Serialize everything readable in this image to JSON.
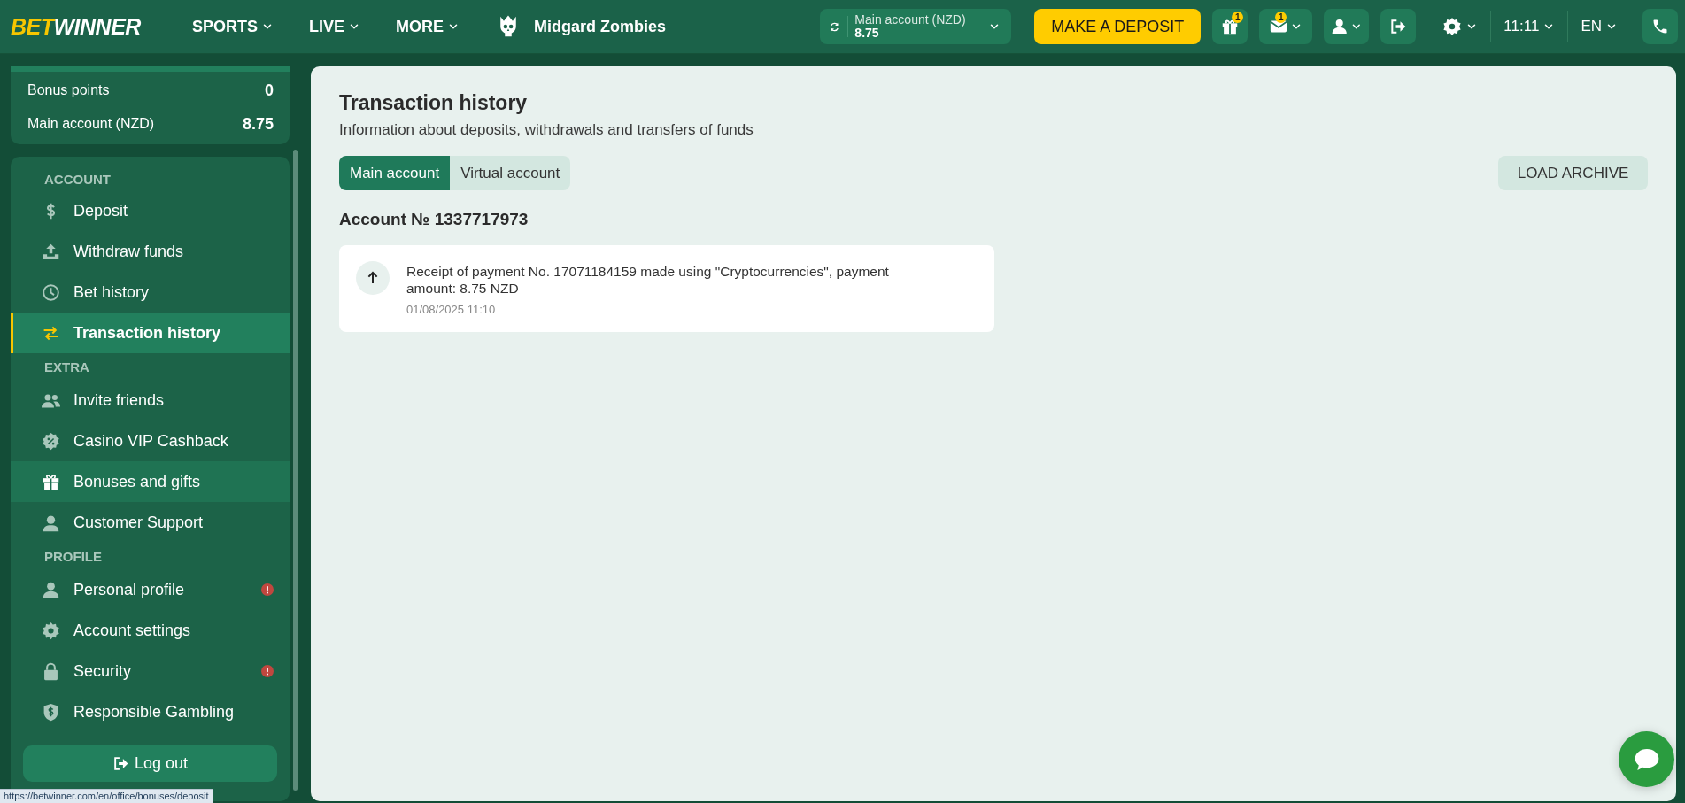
{
  "header": {
    "logo": {
      "accent": "BET",
      "rest": "WINNER"
    },
    "nav": [
      {
        "label": "SPORTS"
      },
      {
        "label": "LIVE"
      },
      {
        "label": "MORE"
      }
    ],
    "game": {
      "label": "Midgard Zombies"
    },
    "account": {
      "label": "Main account (NZD)",
      "balance": "8.75"
    },
    "deposit_button": "MAKE A DEPOSIT",
    "gift_badge": "1",
    "mail_badge": "1",
    "time": "11:11",
    "language": "EN"
  },
  "sidebar": {
    "balances": [
      {
        "label": "Bonus points",
        "value": "0"
      },
      {
        "label": "Main account (NZD)",
        "value": "8.75"
      }
    ],
    "sections": [
      {
        "title": "ACCOUNT",
        "items": [
          {
            "label": "Deposit",
            "selected": false,
            "hovered": false,
            "alert": false
          },
          {
            "label": "Withdraw funds",
            "selected": false,
            "hovered": false,
            "alert": false
          },
          {
            "label": "Bet history",
            "selected": false,
            "hovered": false,
            "alert": false
          },
          {
            "label": "Transaction history",
            "selected": true,
            "hovered": false,
            "alert": false
          }
        ]
      },
      {
        "title": "EXTRA",
        "items": [
          {
            "label": "Invite friends",
            "selected": false,
            "hovered": false,
            "alert": false
          },
          {
            "label": "Casino VIP Cashback",
            "selected": false,
            "hovered": false,
            "alert": false
          },
          {
            "label": "Bonuses and gifts",
            "selected": false,
            "hovered": true,
            "alert": false
          },
          {
            "label": "Customer Support",
            "selected": false,
            "hovered": false,
            "alert": false
          }
        ]
      },
      {
        "title": "PROFILE",
        "items": [
          {
            "label": "Personal profile",
            "selected": false,
            "hovered": false,
            "alert": true
          },
          {
            "label": "Account settings",
            "selected": false,
            "hovered": false,
            "alert": false
          },
          {
            "label": "Security",
            "selected": false,
            "hovered": false,
            "alert": true
          },
          {
            "label": "Responsible Gambling",
            "selected": false,
            "hovered": false,
            "alert": false
          }
        ]
      }
    ],
    "logout": "Log out"
  },
  "main": {
    "title": "Transaction history",
    "subtitle": "Information about deposits, withdrawals and transfers of funds",
    "tabs": [
      {
        "label": "Main account",
        "selected": true
      },
      {
        "label": "Virtual account",
        "selected": false
      }
    ],
    "load_archive": "LOAD ARCHIVE",
    "account_number": "Account № 1337717973",
    "transactions": [
      {
        "text": "Receipt of payment No. 17071184159 made using \"Cryptocurrencies\", payment amount: 8.75 NZD",
        "date": "01/08/2025 11:10"
      }
    ]
  },
  "status_bar": "https://betwinner.com/en/office/bonuses/deposit"
}
